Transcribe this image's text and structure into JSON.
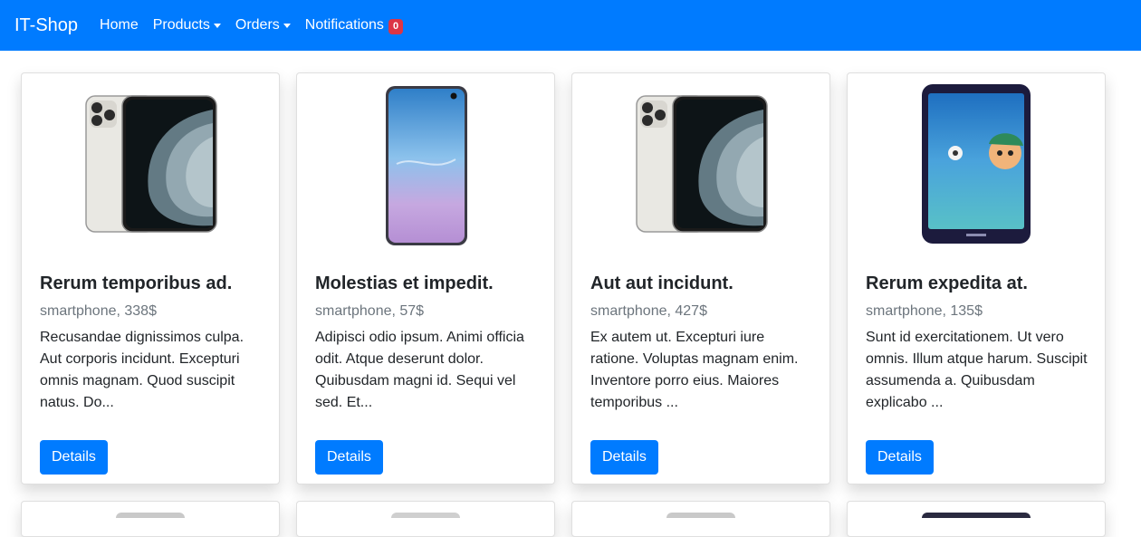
{
  "navbar": {
    "brand": "IT-Shop",
    "items": [
      {
        "label": "Home",
        "dropdown": false
      },
      {
        "label": "Products",
        "dropdown": true
      },
      {
        "label": "Orders",
        "dropdown": true
      },
      {
        "label": "Notifications",
        "dropdown": false,
        "badge": "0"
      }
    ],
    "colors": {
      "bar": "#007bff",
      "badge": "#dc3545"
    }
  },
  "products": [
    {
      "title": "Rerum temporibus ad.",
      "subtitle": "smartphone, 338$",
      "description": "Recusandae dignissimos culpa. Aut corporis incidunt. Excepturi omnis magnam. Quod suscipit natus. Do...",
      "button": "Details",
      "image": "iphone-11-pro-silver"
    },
    {
      "title": "Molestias et impedit.",
      "subtitle": "smartphone, 57$",
      "description": "Adipisci odio ipsum. Animi officia odit. Atque deserunt dolor. Quibusdam magni id. Sequi vel sed. Et...",
      "button": "Details",
      "image": "galaxy-s10-blue-pink"
    },
    {
      "title": "Aut aut incidunt.",
      "subtitle": "smartphone, 427$",
      "description": "Ex autem ut. Excepturi iure ratione. Voluptas magnam enim. Inventore porro eius. Maiores temporibus ...",
      "button": "Details",
      "image": "iphone-11-pro-silver"
    },
    {
      "title": "Rerum expedita at.",
      "subtitle": "smartphone, 135$",
      "description": "Sunt id exercitationem. Ut vero omnis. Illum atque harum. Suscipit assumenda a. Quibusdam explicabo ...",
      "button": "Details",
      "image": "hisense-navy-cartoon"
    }
  ],
  "colors": {
    "primary": "#007bff",
    "muted": "#6c757d",
    "text": "#212529"
  }
}
